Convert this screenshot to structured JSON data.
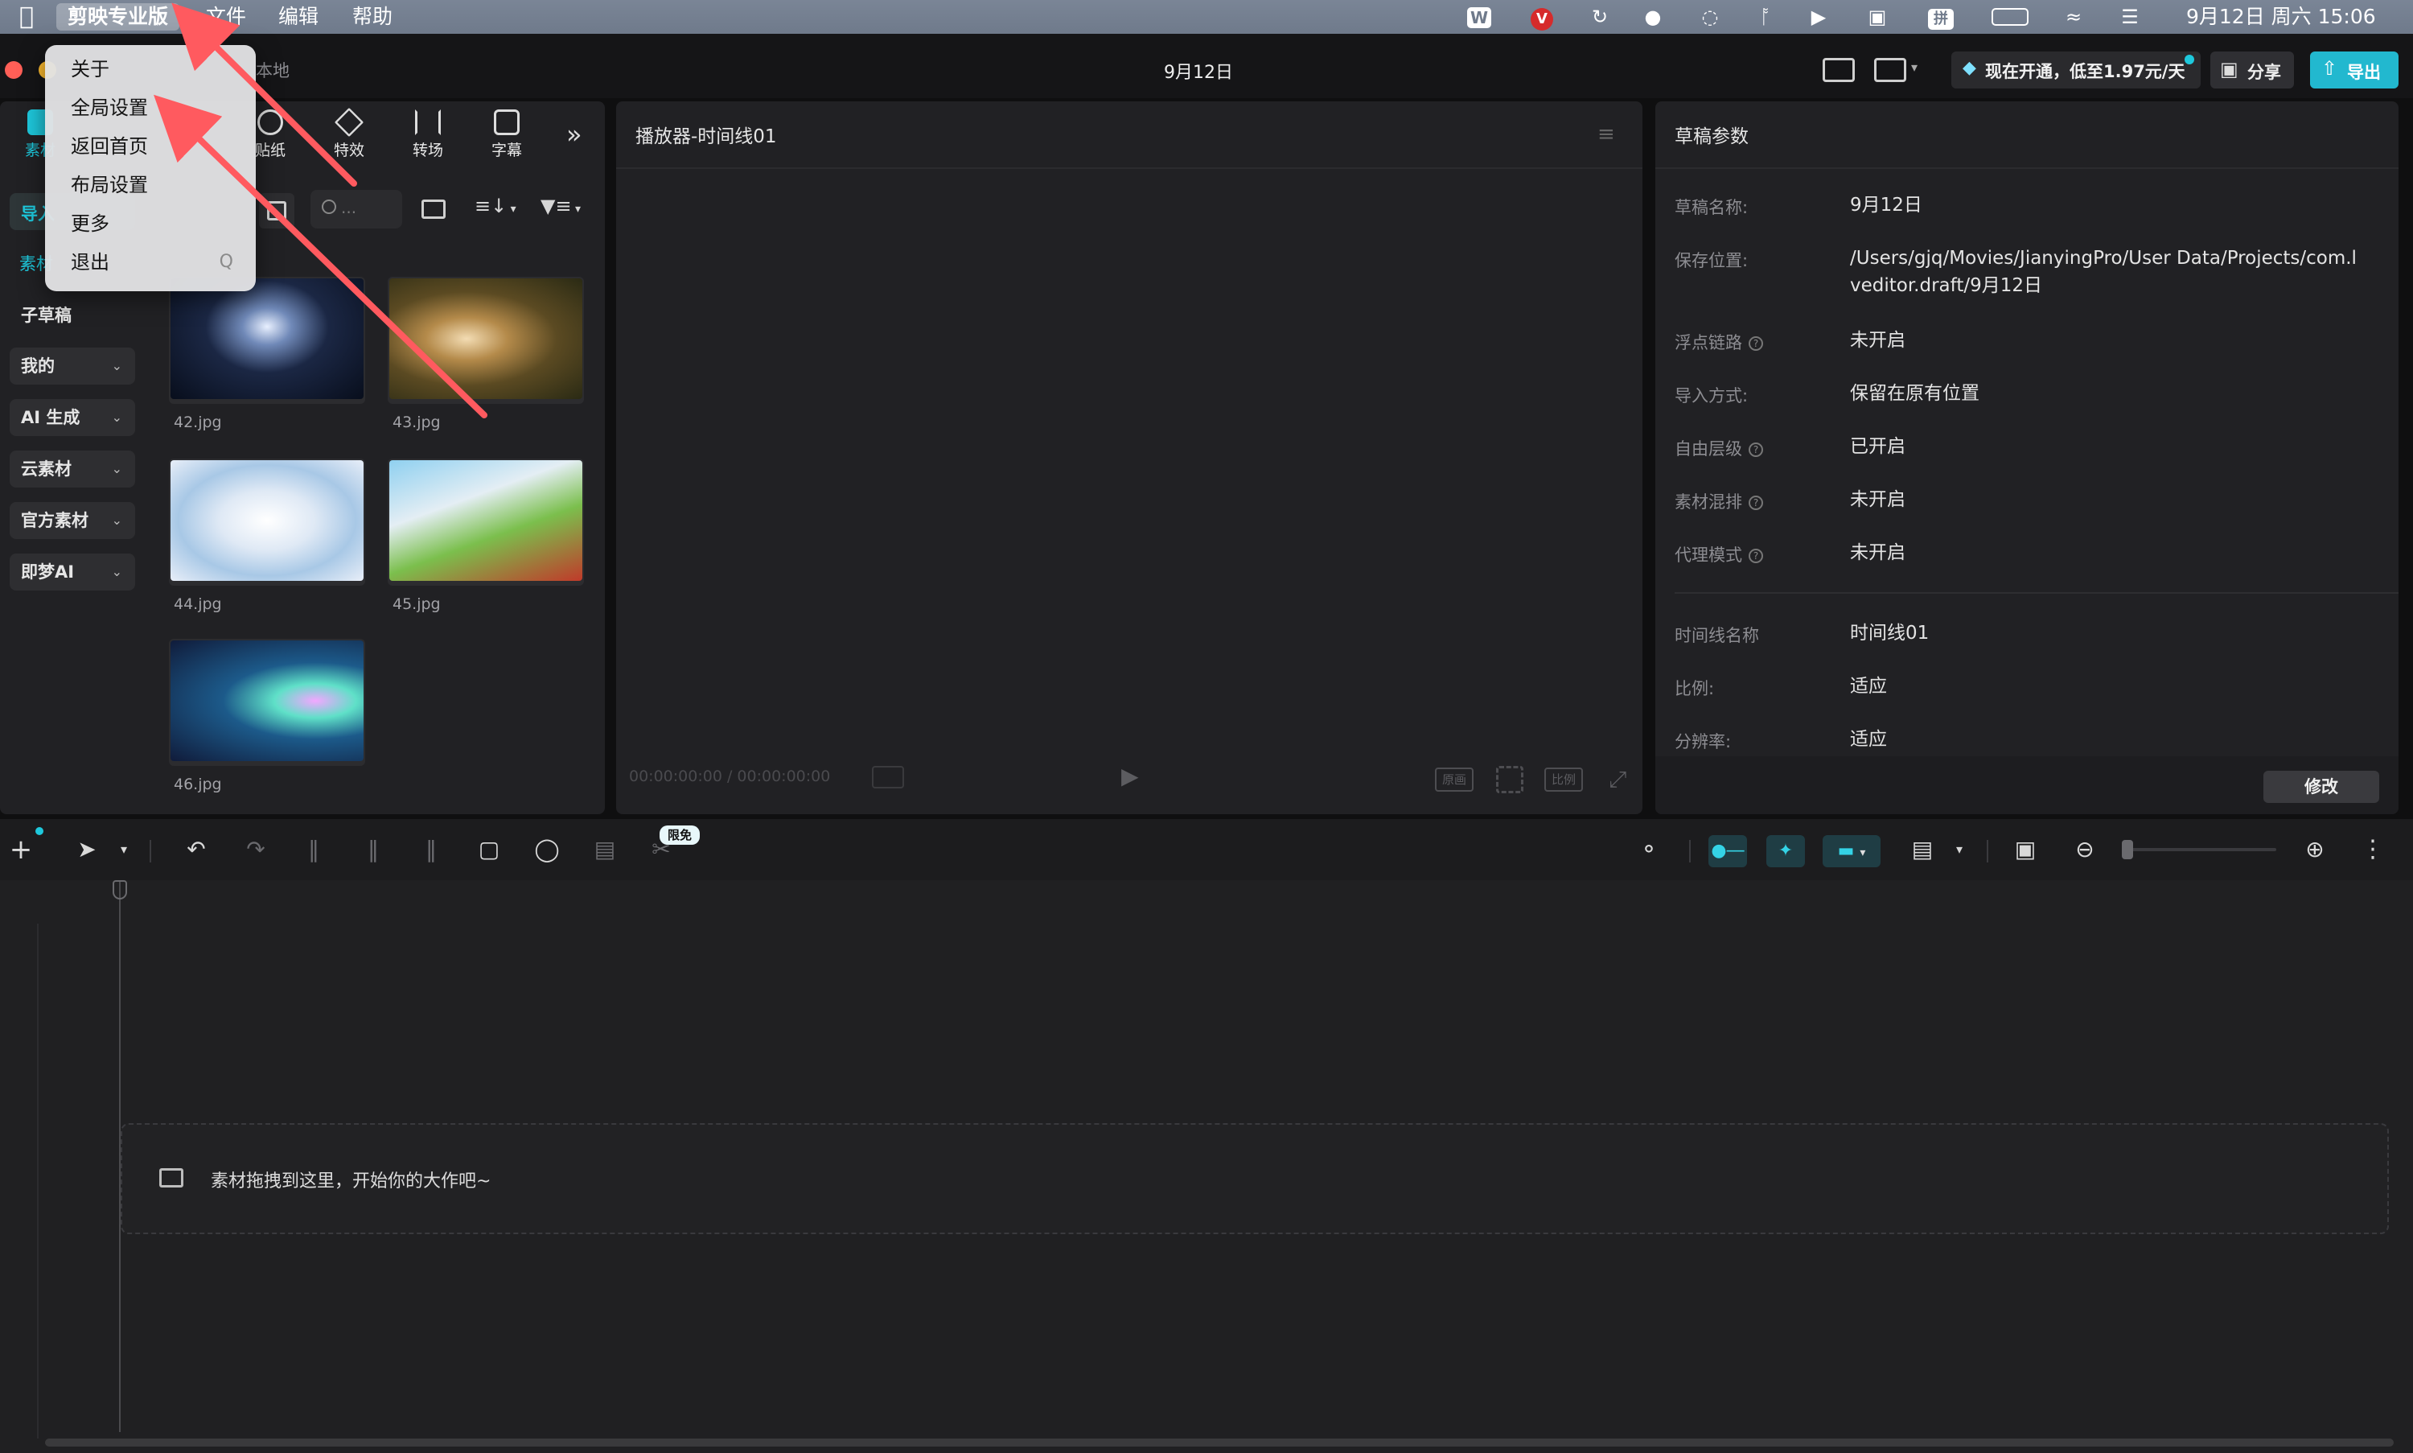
{
  "menubar": {
    "app_name": "剪映专业版",
    "menus": [
      "文件",
      "编辑",
      "帮助"
    ],
    "datetime": "9月12日 周六  15:06",
    "tray_icons": [
      "wps-icon",
      "vivaldi-icon",
      "sync-icon",
      "bell-icon",
      "wechat-icon",
      "bluetooth-icon",
      "play-icon",
      "camera-icon",
      "input-method-icon",
      "battery-icon",
      "wifi-icon",
      "control-center-icon"
    ],
    "input_method_label": "拼"
  },
  "app_menu": {
    "items": [
      {
        "label": "关于",
        "shortcut": ""
      },
      {
        "label": "全局设置",
        "shortcut": ""
      },
      {
        "label": "返回首页",
        "shortcut": ""
      },
      {
        "label": "布局设置",
        "shortcut": ""
      },
      {
        "label": "更多",
        "shortcut": ""
      },
      {
        "label": "退出",
        "shortcut": "Q"
      }
    ]
  },
  "window": {
    "title": "9月12日",
    "left_crumb": "本地",
    "promo": "现在开通，低至1.97元/天",
    "share_label": "分享",
    "export_label": "导出"
  },
  "tools": {
    "tabs": [
      "素材",
      "贴纸",
      "特效",
      "转场",
      "字幕"
    ],
    "more": "»"
  },
  "library": {
    "import_label": "导入",
    "material_label": "素材",
    "search_placeholder": "...",
    "categories": [
      {
        "label": "子草稿",
        "has_chevron": false
      },
      {
        "label": "我的",
        "has_chevron": true
      },
      {
        "label": "AI 生成",
        "has_chevron": true
      },
      {
        "label": "云素材",
        "has_chevron": true
      },
      {
        "label": "官方素材",
        "has_chevron": true
      },
      {
        "label": "即梦AI",
        "has_chevron": true
      }
    ],
    "files": [
      "42.jpg",
      "43.jpg",
      "44.jpg",
      "45.jpg",
      "46.jpg"
    ]
  },
  "player": {
    "title": "播放器-时间线01",
    "timecode_current": "00:00:00:00",
    "timecode_total": "00:00:00:00",
    "original_label": "原画",
    "ratio_label": "比例"
  },
  "params": {
    "title": "草稿参数",
    "rows": [
      {
        "label": "草稿名称:",
        "value": "9月12日",
        "help": false
      },
      {
        "label": "保存位置:",
        "value": "/Users/gjq/Movies/JianyingPro/User Data/Projects/com.lveditor.draft/9月12日",
        "help": false
      },
      {
        "label": "浮点链路",
        "value": "未开启",
        "help": true
      },
      {
        "label": "导入方式:",
        "value": "保留在原有位置",
        "help": false
      },
      {
        "label": "自由层级",
        "value": "已开启",
        "help": true
      },
      {
        "label": "素材混排",
        "value": "未开启",
        "help": true
      },
      {
        "label": "代理模式",
        "value": "未开启",
        "help": true
      }
    ],
    "rows2": [
      {
        "label": "时间线名称",
        "value": "时间线01"
      },
      {
        "label": "比例:",
        "value": "适应"
      },
      {
        "label": "分辨率:",
        "value": "适应"
      }
    ],
    "modify_label": "修改"
  },
  "timeline": {
    "free_badge": "限免",
    "drop_hint": "素材拖拽到这里，开始你的大作吧~"
  },
  "colors": {
    "accent": "#1ec8dc",
    "annotation_arrow": "#ff5a5f"
  }
}
